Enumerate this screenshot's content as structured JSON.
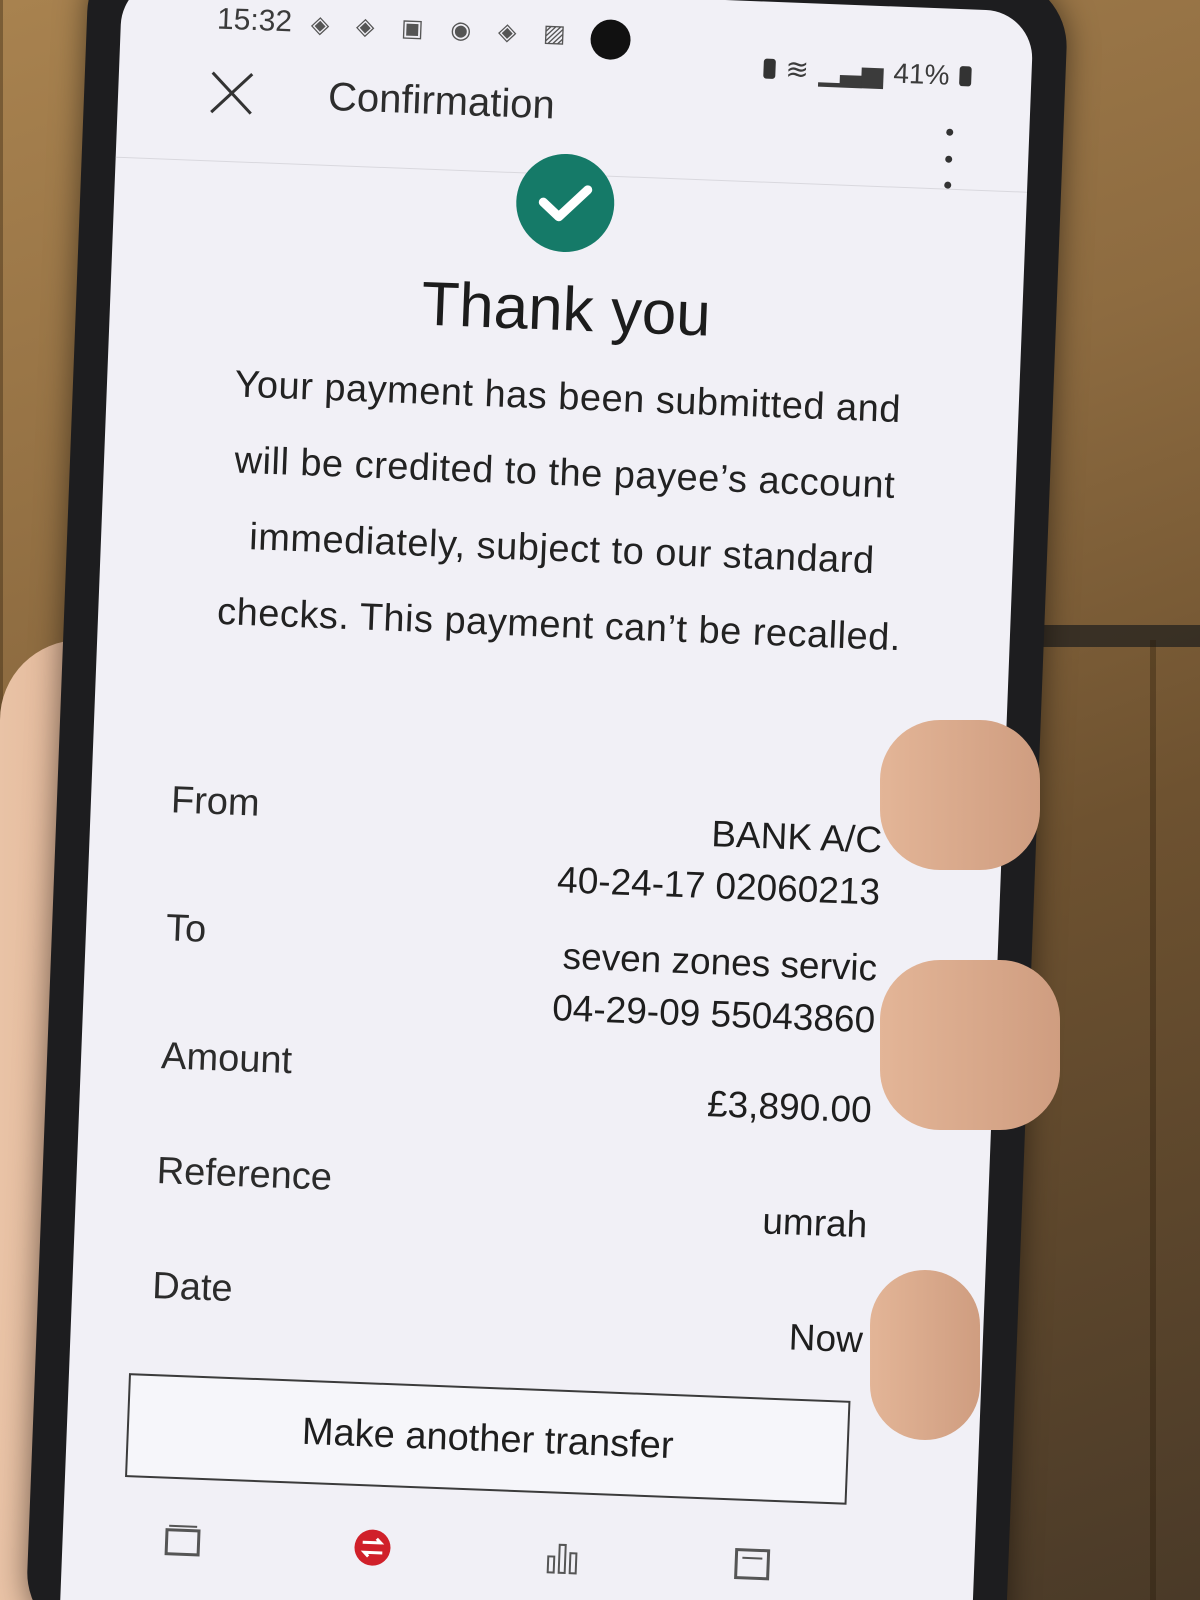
{
  "status_bar": {
    "time": "15:32",
    "battery": "41%"
  },
  "app_bar": {
    "title": "Confirmation"
  },
  "confirmation": {
    "heading": "Thank you",
    "message": "Your payment has been submitted and will be credited to the payee’s account immediately, subject to our standard checks. This payment can’t be recalled."
  },
  "details": [
    {
      "label": "From",
      "value_line1": "BANK A/C",
      "value_line2": "40-24-17 02060213"
    },
    {
      "label": "To",
      "value_line1": "seven zones servic",
      "value_line2": "04-29-09 55043860"
    },
    {
      "label": "Amount",
      "value_line1": "£3,890.00",
      "value_line2": ""
    },
    {
      "label": "Reference",
      "value_line1": "umrah",
      "value_line2": ""
    },
    {
      "label": "Date",
      "value_line1": "Now",
      "value_line2": ""
    }
  ],
  "actions": {
    "make_another_transfer": "Make another transfer"
  },
  "colors": {
    "success": "#157a68",
    "nav_accent": "#d0202a"
  },
  "nav": [
    "wallet-icon",
    "transfer-icon",
    "chart-icon",
    "document-icon"
  ]
}
